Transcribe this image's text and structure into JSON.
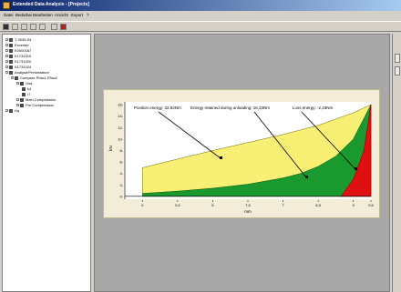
{
  "window": {
    "title": "Extended Data Analysis - [Projects]"
  },
  "menu": {
    "items": [
      "Datei",
      "Bedarbei",
      "Bearbeiten",
      "Ansicht",
      "Export",
      "?"
    ]
  },
  "toolbar": {
    "buttons": [
      "new-icon",
      "open-icon",
      "save-icon",
      "print-icon",
      "cut-icon",
      "chart-icon",
      "close-icon"
    ]
  },
  "tree": {
    "items": [
      {
        "label": "T-3039-94",
        "level": 0
      },
      {
        "label": "Excenter",
        "level": 0
      },
      {
        "label": "K0000187",
        "level": 0
      },
      {
        "label": "K1731019",
        "level": 0
      },
      {
        "label": "K1731020",
        "level": 0
      },
      {
        "label": "K1731024",
        "level": 0
      },
      {
        "label": "Analyse/Presentation",
        "level": 0
      },
      {
        "label": "Compare Phsc1-Phsc2",
        "level": 1
      },
      {
        "label": "Gsa",
        "level": 2
      },
      {
        "label": "k4",
        "level": 3
      },
      {
        "label": "r7",
        "level": 3
      },
      {
        "label": "Main Compression",
        "level": 2
      },
      {
        "label": "Pre Compression",
        "level": 2
      },
      {
        "label": "Hq",
        "level": 0
      }
    ]
  },
  "chart_data": {
    "type": "area",
    "title": "",
    "xlabel": "mm",
    "ylabel": "kN",
    "xlim": [
      3.5,
      10.5
    ],
    "ylim": [
      -0.5,
      16.5
    ],
    "x_ticks": [
      "0",
      "0,5",
      "5",
      "7,5",
      "7",
      "8,5",
      "9",
      "9,5"
    ],
    "x_tick_values": [
      4,
      5,
      6,
      7,
      8,
      9,
      10,
      10.5
    ],
    "y_ticks": [
      0,
      2,
      4,
      6,
      8,
      10,
      12,
      14,
      16
    ],
    "y_tick_labels": [
      "0-",
      "2-",
      "4-",
      "6-",
      "8-",
      "10-",
      "12-",
      "14-",
      "16-"
    ],
    "series": [
      {
        "name": "Position energy",
        "color": "#f7f074",
        "x": [
          4,
          5,
          6,
          7,
          8,
          9,
          10,
          10.5
        ],
        "y": [
          5.0,
          6.5,
          8.0,
          9.4,
          10.8,
          12.4,
          14.6,
          16.0
        ]
      },
      {
        "name": "Energy retained during unloading",
        "color": "#1a9a2e",
        "x": [
          4,
          5,
          6,
          7,
          8,
          8.5,
          9,
          9.5,
          10,
          10.5
        ],
        "y": [
          0.5,
          0.9,
          1.4,
          2.1,
          3.2,
          4.0,
          5.2,
          7.0,
          10.0,
          16.0
        ]
      },
      {
        "name": "Loss energy",
        "color": "#e01010",
        "x": [
          9.65,
          10,
          10.3,
          10.5
        ],
        "y": [
          0,
          3.0,
          8.0,
          16.0
        ]
      }
    ],
    "annotations": [
      {
        "text": "Position energy: 32,84Nm"
      },
      {
        "text": "Energy retained during unloading: 16,33Nm"
      },
      {
        "text": "Loss energy: -2,43Nm"
      }
    ]
  }
}
